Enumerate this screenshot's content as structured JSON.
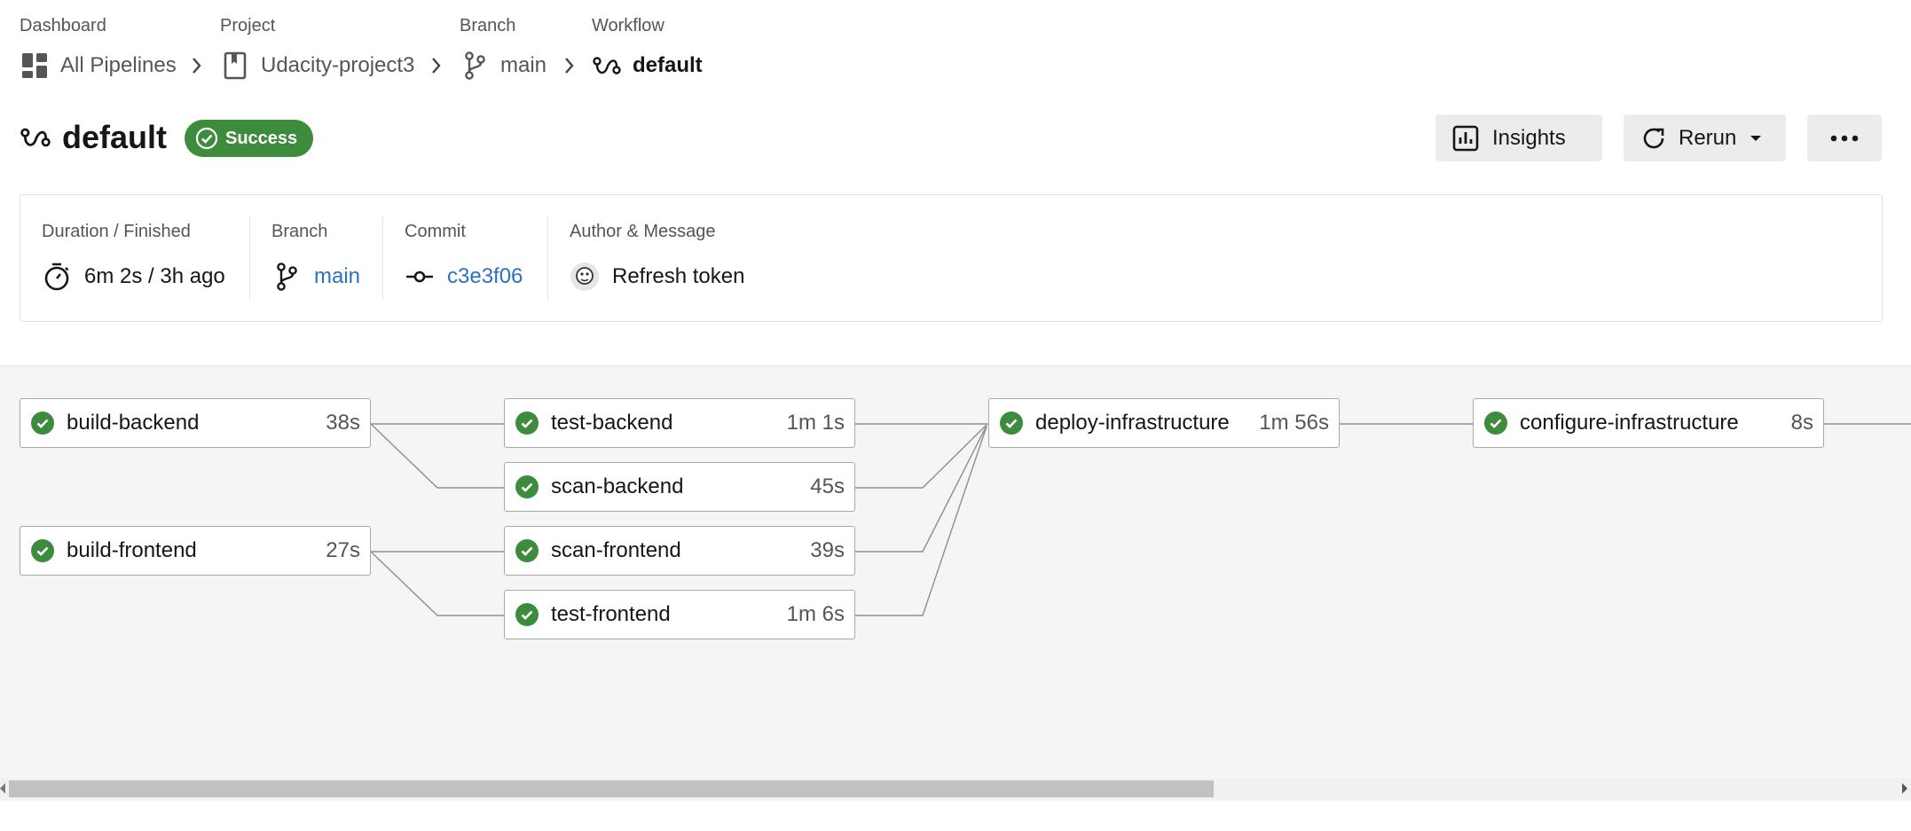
{
  "breadcrumb": {
    "items": [
      {
        "heading": "Dashboard",
        "label": "All Pipelines",
        "icon": "dashboard-icon"
      },
      {
        "heading": "Project",
        "label": "Udacity-project3",
        "icon": "project-icon"
      },
      {
        "heading": "Branch",
        "label": "main",
        "icon": "branch-icon"
      },
      {
        "heading": "Workflow",
        "label": "default",
        "icon": "workflow-icon"
      }
    ]
  },
  "header": {
    "title": "default",
    "status": "Success",
    "status_color": "#3d8b3d",
    "buttons": {
      "insights": "Insights",
      "rerun": "Rerun"
    }
  },
  "summary": {
    "duration_label": "Duration / Finished",
    "duration_value": "6m 2s / 3h ago",
    "branch_label": "Branch",
    "branch_value": "main",
    "commit_label": "Commit",
    "commit_value": "c3e3f06",
    "author_label": "Author & Message",
    "message": "Refresh token",
    "link_color": "#2f6fbf"
  },
  "jobs": [
    {
      "name": "build-backend",
      "duration": "38s",
      "status": "success"
    },
    {
      "name": "build-frontend",
      "duration": "27s",
      "status": "success"
    },
    {
      "name": "test-backend",
      "duration": "1m 1s",
      "status": "success"
    },
    {
      "name": "scan-backend",
      "duration": "45s",
      "status": "success"
    },
    {
      "name": "scan-frontend",
      "duration": "39s",
      "status": "success"
    },
    {
      "name": "test-frontend",
      "duration": "1m 6s",
      "status": "success"
    },
    {
      "name": "deploy-infrastructure",
      "duration": "1m 56s",
      "status": "success"
    },
    {
      "name": "configure-infrastructure",
      "duration": "8s",
      "status": "success"
    }
  ]
}
